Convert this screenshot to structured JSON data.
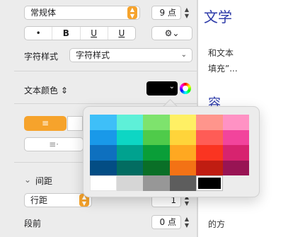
{
  "font": {
    "family": "常规体",
    "size_value": "9 点"
  },
  "style_buttons": [
    "•",
    "B",
    "U",
    "U"
  ],
  "gear_label": "⚙︎⌄",
  "char_style": {
    "label": "字符样式",
    "value": "字符样式"
  },
  "text_color": {
    "label": "文本颜色 ⇕",
    "color": "#000000"
  },
  "spacing": {
    "label": "间距",
    "line_spacing": "行距",
    "line_value": "1",
    "before_label": "段前",
    "before_value": "0 点"
  },
  "doc": {
    "title": "文学",
    "line1": "和文本",
    "line2": "填充”...",
    "accent": "容",
    "line3": "的方"
  },
  "palette": {
    "rows": [
      [
        "#3ebff8",
        "#5ef0d8",
        "#7ee36d",
        "#fff064",
        "#ff958c",
        "#ff92c4"
      ],
      [
        "#1999e9",
        "#0dd6c4",
        "#4fcb4a",
        "#ffd43a",
        "#ff5c56",
        "#f2449c"
      ],
      [
        "#0e70bf",
        "#00a28f",
        "#0a9e38",
        "#ffa821",
        "#fa3421",
        "#d7236f"
      ],
      [
        "#034d84",
        "#026c61",
        "#0a6f27",
        "#f37215",
        "#c01d12",
        "#981454"
      ],
      [
        "#ffffff",
        "#d6d6d6",
        "#979797",
        "#5d5d5d",
        "#000000",
        null
      ]
    ]
  }
}
